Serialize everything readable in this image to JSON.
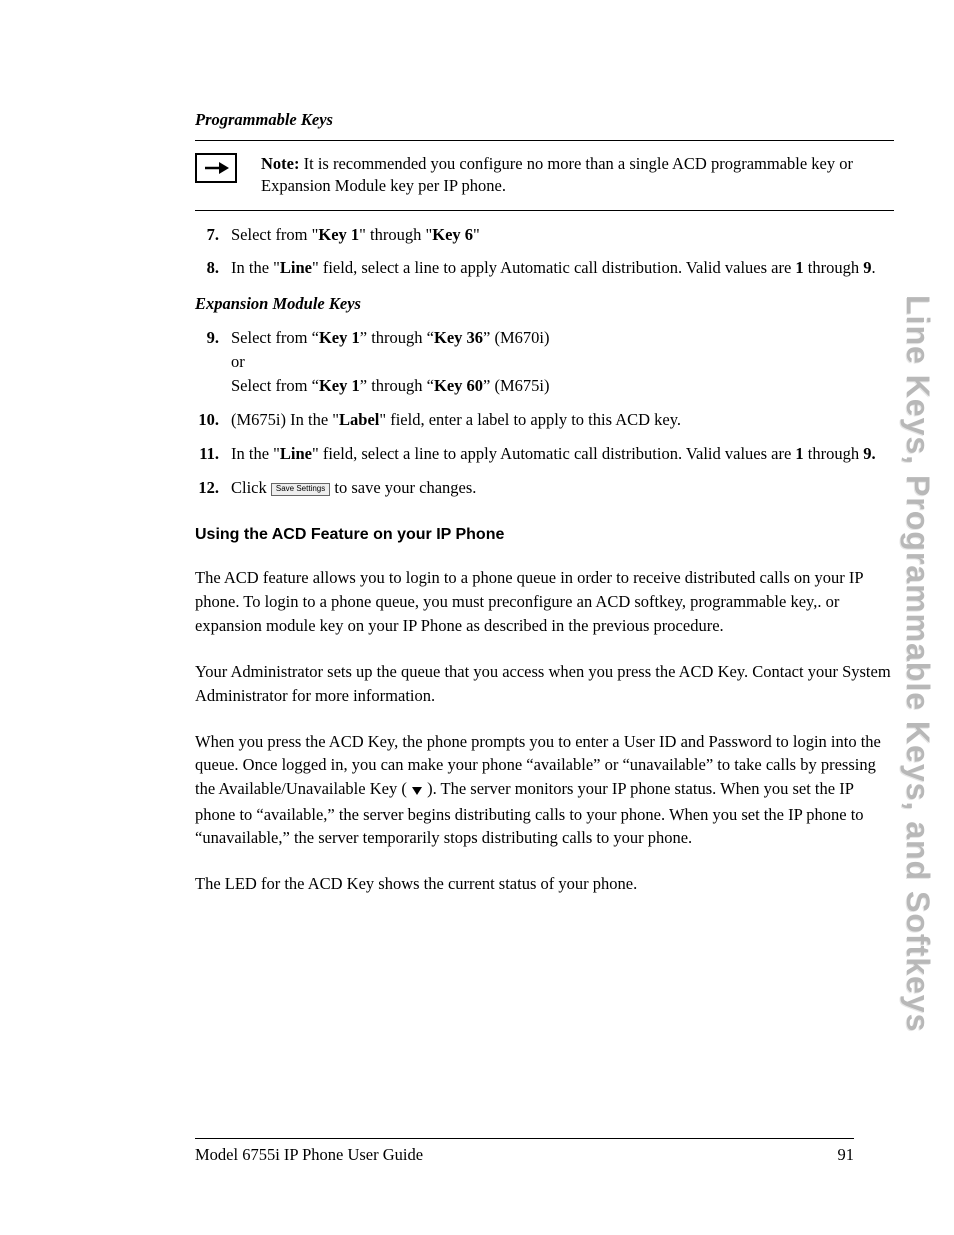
{
  "side_tab": "Line Keys, Programmable Keys, and Softkeys",
  "breadcrumb": "Programmable Keys",
  "note": {
    "label": "Note:",
    "text": " It is recommended you configure no more than a single ACD programmable key or Expansion Module key per IP phone."
  },
  "steps_a": [
    {
      "n": "7.",
      "parts": [
        "Select from \"",
        "Key 1",
        "\" through \"",
        "Key 6",
        "\""
      ]
    },
    {
      "n": "8.",
      "parts": [
        "In the \"",
        "Line",
        "\" field, select a line to apply Automatic call distribution. Valid values are ",
        "1",
        " through ",
        "9",
        "."
      ]
    }
  ],
  "sub_head": "Expansion Module Keys",
  "steps_b": [
    {
      "n": "9.",
      "parts": [
        "Select from “",
        "Key 1",
        "” through “",
        "Key 36",
        "” (M670i)",
        "<br>",
        "or",
        "<br>",
        "Select from “",
        "Key 1",
        "” through “",
        "Key 60",
        "” (M675i)"
      ]
    },
    {
      "n": "10.",
      "parts": [
        "(M675i) In the \"",
        "Label",
        "\" field, enter a label to apply to this ACD key."
      ]
    },
    {
      "n": "11.",
      "parts": [
        "In the \"",
        "Line",
        "\" field, select a line to apply Automatic call distribution. Valid values are ",
        "1",
        " through ",
        "9."
      ]
    },
    {
      "n": "12.",
      "parts": [
        "Click ",
        "<btn>",
        " to save your changes."
      ]
    }
  ],
  "btn_label": "Save Settings",
  "h3": "Using the ACD Feature on your IP Phone",
  "paras": [
    "The ACD feature allows you to login to a phone queue in order to receive distributed calls on your IP phone. To login to a phone queue, you must preconfigure an ACD softkey, programmable key,. or expansion module key on your IP Phone as described in the previous procedure.",
    "Your Administrator sets up the queue that you access when you press the ACD Key. Contact your System Administrator for more information.",
    "When you press the ACD Key, the phone prompts you to enter a User ID and Password to login into the queue. Once logged in, you can make your phone “available” or “unavailable” to take calls by pressing the Available/Unavailable Key ( <tri> ). The server monitors your IP phone status. When you set the IP phone to “available,” the server begins distributing calls to your phone. When you set the IP phone to “unavailable,” the server temporarily stops distributing calls to your phone.",
    "The LED for the ACD Key shows the current status of your phone."
  ],
  "footer": {
    "left": "Model 6755i IP Phone User Guide",
    "right": "91"
  }
}
